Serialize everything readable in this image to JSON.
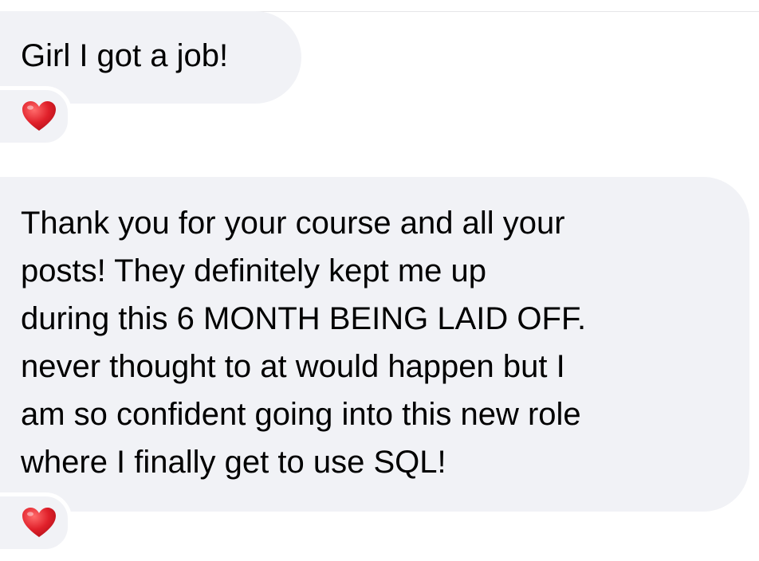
{
  "messages": [
    {
      "text": "Girl I got a job!",
      "reaction": "heart-icon"
    },
    {
      "lines": [
        "Thank you for your course and all your",
        "posts! They definitely kept me up",
        "during this 6 MONTH BEING LAID OFF.",
        "never thought to at would happen but I",
        "am so confident going into this new role",
        "where I finally get to use SQL!"
      ],
      "reaction": "heart-icon"
    }
  ],
  "colors": {
    "bubble_background": "#f1f2f6",
    "text": "#000000",
    "heart": "#e0202a"
  }
}
